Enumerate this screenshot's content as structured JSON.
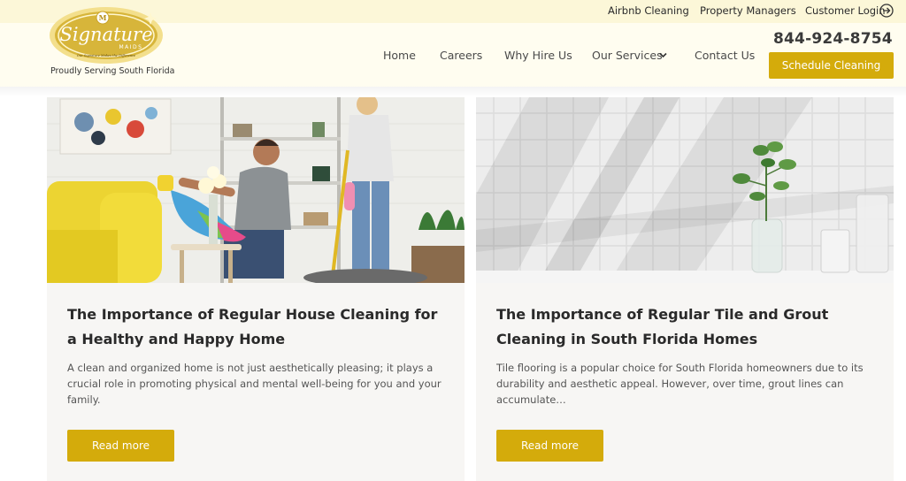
{
  "topbar": {
    "links": [
      "Airbnb Cleaning",
      "Property Managers",
      "Customer Login"
    ]
  },
  "header": {
    "logo_text": "Signature",
    "logo_subtext": "MAIDS",
    "logo_slogan": "Our Signature Makes the Difference",
    "tagline": "Proudly Serving South Florida",
    "nav": [
      "Home",
      "Careers",
      "Why Hire Us",
      "Our Services",
      "Contact Us"
    ],
    "phone": "844-924-8754",
    "cta_label": "Schedule Cleaning"
  },
  "posts": [
    {
      "title": "The Importance of Regular House Cleaning for a Healthy and Happy Home",
      "excerpt": "A clean and organized home is not just aesthetically pleasing; it plays a crucial role in promoting physical and mental well-being for you and your family.",
      "button": "Read more",
      "image": "couple-cleaning-living-room-photo"
    },
    {
      "title": "The Importance of Regular Tile and Grout Cleaning in South Florida Homes",
      "excerpt": "Tile flooring is a popular choice for South Florida homeowners due to its durability and aesthetic appeal. However, over time, grout lines can accumulate…",
      "button": "Read more",
      "image": "white-tile-wall-with-plant-photo"
    }
  ],
  "colors": {
    "accent": "#d4ab0b",
    "topbar_bg": "#fcf7d8",
    "header_bg": "#fffdf0",
    "card_bg": "#f7f6f4"
  }
}
